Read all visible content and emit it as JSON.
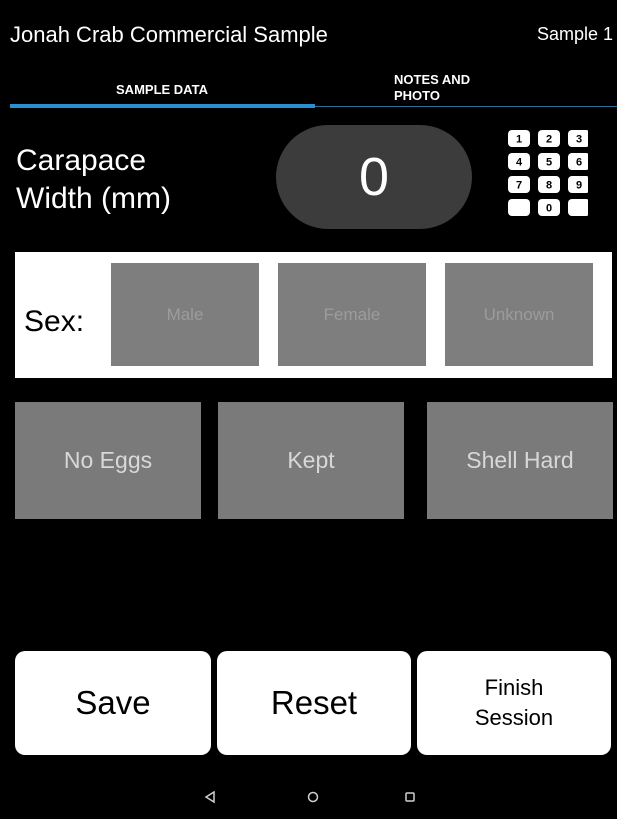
{
  "header": {
    "title": "Jonah Crab Commercial Sample",
    "sample": "Sample 1"
  },
  "tabs": {
    "sample_data": "SAMPLE DATA",
    "notes_line1": "NOTES AND",
    "notes_line2": "PHOTO"
  },
  "carapace": {
    "label_line1": "Carapace",
    "label_line2": "Width (mm)",
    "value": "0"
  },
  "keypad": {
    "icon": "keypad-icon",
    "digits": [
      "1",
      "2",
      "3",
      "4",
      "5",
      "6",
      "7",
      "8",
      "9",
      "",
      "0",
      ""
    ]
  },
  "sex": {
    "label": "Sex:",
    "male": "Male",
    "female": "Female",
    "unknown": "Unknown"
  },
  "toggles": {
    "eggs": "No Eggs",
    "kept": "Kept",
    "shell": "Shell Hard"
  },
  "actions": {
    "save": "Save",
    "reset": "Reset",
    "finish_line1": "Finish",
    "finish_line2": "Session"
  },
  "navbar": {
    "back_icon": "back-icon",
    "home_icon": "home-icon",
    "recent_icon": "recent-apps-icon"
  },
  "colors": {
    "tab_accent": "#2a8fd1",
    "button_gray": "#7a7a7a",
    "value_pill": "#3c3c3c"
  }
}
